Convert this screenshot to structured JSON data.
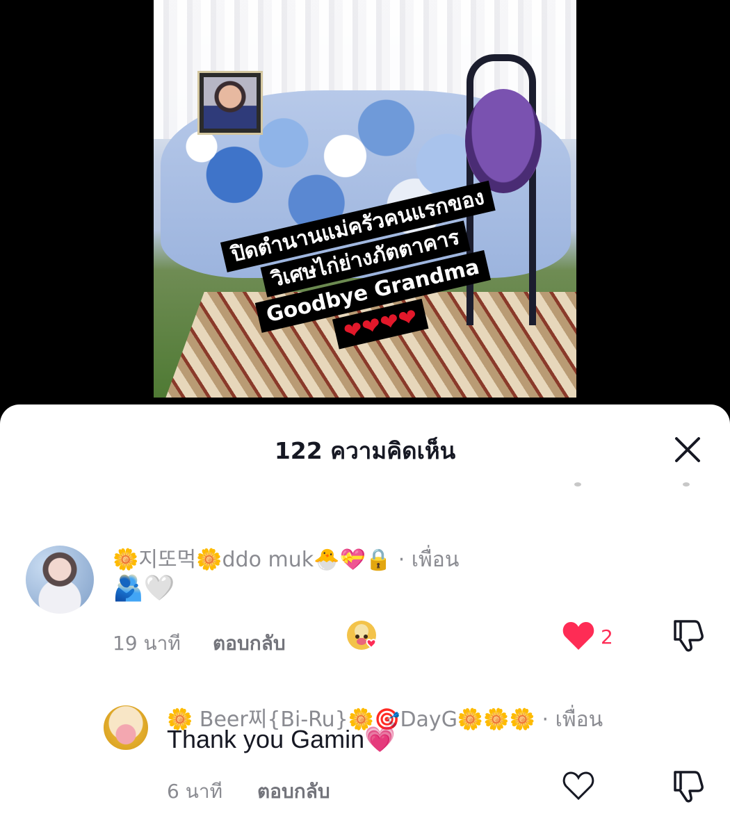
{
  "video": {
    "caption_lines": [
      "ปิดตำนานแม่ครัวคนแรกของ",
      "วิเศษไก่ย่างภัตตาคาร",
      "Goodbye Grandma"
    ],
    "caption_hearts": "❤❤❤❤"
  },
  "sheet": {
    "title": "122 ความคิดเห็น",
    "close_icon": "close-icon"
  },
  "comments": [
    {
      "username": "🌼지또먹🌼ddo muk🐣💝🔒",
      "friend_label": "· เพื่อน",
      "text": "🫂🤍",
      "time": "19 นาที",
      "reply_label": "ตอบกลับ",
      "liked": true,
      "like_count": "2",
      "creator_liked_icon": "creator-liked-avatar-icon"
    },
    {
      "username": "🌼 Beer찌{Bi-Ru}🌼🎯DayG🌼🌼🌼",
      "friend_label": "· เพื่อน",
      "text": "Thank you Gamin💗",
      "time": "6 นาที",
      "reply_label": "ตอบกลับ",
      "liked": false
    }
  ],
  "colors": {
    "accent_like": "#fe2c55",
    "text_primary": "#161823",
    "text_secondary": "#8a8b91"
  }
}
